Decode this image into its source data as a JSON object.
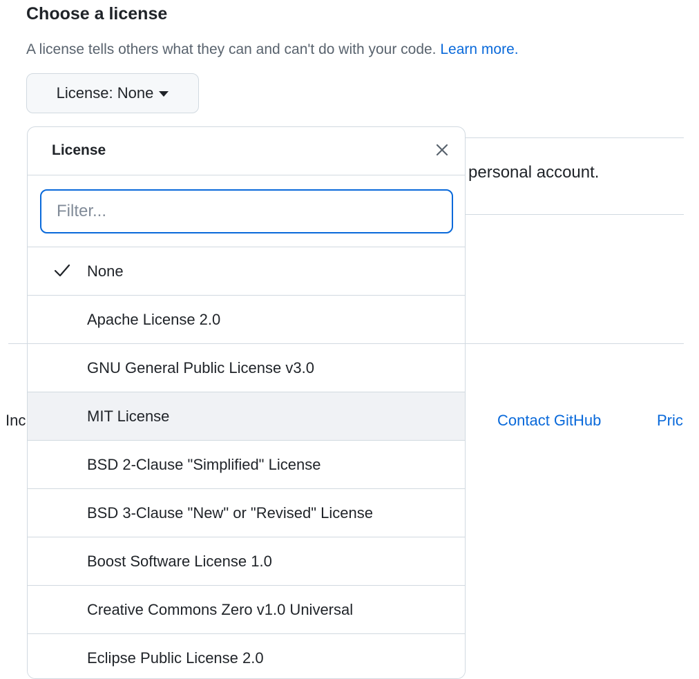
{
  "section": {
    "title": "Choose a license",
    "description": "A license tells others what they can and can't do with your code.",
    "learn_more": "Learn more."
  },
  "license_button": {
    "label": "License: None"
  },
  "background": {
    "personal_text": "personal account.",
    "footer_fragment": "Inc",
    "contact_link": "Contact GitHub",
    "pricing_link": "Pricing"
  },
  "dropdown": {
    "title": "License",
    "filter_placeholder": "Filter...",
    "selected_index": 0,
    "hovered_index": 3,
    "items": [
      {
        "label": "None"
      },
      {
        "label": "Apache License 2.0"
      },
      {
        "label": "GNU General Public License v3.0"
      },
      {
        "label": "MIT License"
      },
      {
        "label": "BSD 2-Clause \"Simplified\" License"
      },
      {
        "label": "BSD 3-Clause \"New\" or \"Revised\" License"
      },
      {
        "label": "Boost Software License 1.0"
      },
      {
        "label": "Creative Commons Zero v1.0 Universal"
      },
      {
        "label": "Eclipse Public License 2.0"
      }
    ]
  },
  "colors": {
    "accent": "#0969da",
    "text": "#1f2328",
    "muted": "#59636e",
    "border": "#d1d9e0",
    "hover": "#f0f2f5"
  },
  "icons": {
    "close": "close-icon",
    "check": "check-icon",
    "caret": "caret-down-icon"
  }
}
